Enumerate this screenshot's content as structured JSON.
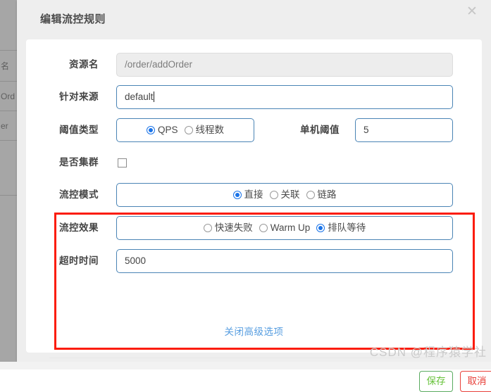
{
  "background": {
    "table_cells": [
      "名",
      "Ord",
      "er"
    ]
  },
  "dialog": {
    "title": "编辑流控规则",
    "close_icon": "close-icon",
    "fields": {
      "resource": {
        "label": "资源名",
        "value": "/order/addOrder",
        "disabled": true
      },
      "source": {
        "label": "针对来源",
        "value": "default",
        "focused": true
      },
      "threshold_type": {
        "label": "阈值类型",
        "options": [
          {
            "label": "QPS",
            "checked": true
          },
          {
            "label": "线程数",
            "checked": false
          }
        ]
      },
      "single_threshold": {
        "label": "单机阈值",
        "value": "5"
      },
      "is_cluster": {
        "label": "是否集群",
        "checked": false
      },
      "flow_mode": {
        "label": "流控模式",
        "options": [
          {
            "label": "直接",
            "checked": true
          },
          {
            "label": "关联",
            "checked": false
          },
          {
            "label": "链路",
            "checked": false
          }
        ]
      },
      "flow_effect": {
        "label": "流控效果",
        "options": [
          {
            "label": "快速失败",
            "checked": false
          },
          {
            "label": "Warm Up",
            "checked": false
          },
          {
            "label": "排队等待",
            "checked": true
          }
        ]
      },
      "timeout": {
        "label": "超时时间",
        "value": "5000"
      }
    },
    "advanced_link": "关闭高级选项",
    "buttons": {
      "save": "保存",
      "cancel": "取消"
    }
  },
  "watermark": "CSDN @程序猿学社",
  "colors": {
    "accent_blue": "#409EFF",
    "highlight_red": "#FB1C0A",
    "save_green": "#67C23A",
    "cancel_red": "#E8403A"
  }
}
